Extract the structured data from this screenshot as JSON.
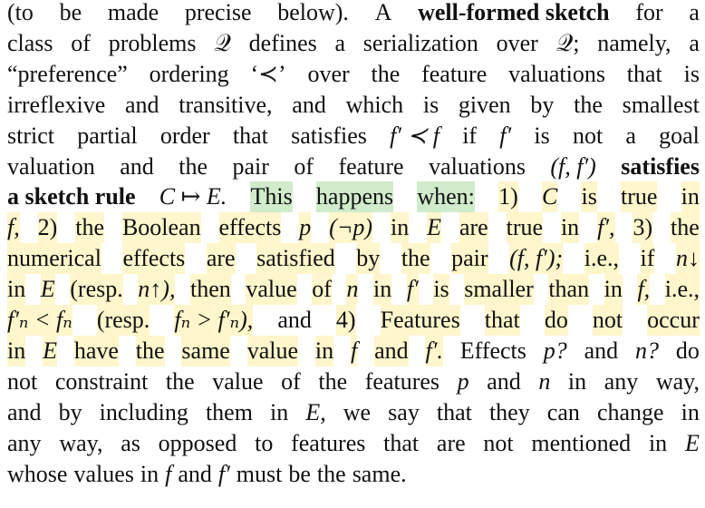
{
  "paragraph": {
    "lines": [
      [
        "(to",
        "be",
        "made",
        "precise",
        "below).",
        "A",
        "well-formed sketch",
        "for",
        "a"
      ],
      [
        "class",
        "of",
        "problems",
        "𝒬",
        "defines",
        "a",
        "serialization",
        "over",
        "𝒬;",
        "namely,",
        "a"
      ],
      [
        "“preference”",
        "ordering",
        "‘≺’",
        "over",
        "the",
        "feature",
        "valuations",
        "that",
        "is"
      ],
      [
        "irreflexive",
        "and",
        "transitive,",
        "and",
        "which",
        "is",
        "given",
        "by",
        "the",
        "smallest"
      ],
      [
        "strict",
        "partial",
        "order",
        "that",
        "satisfies",
        "f′ ≺ f",
        "if",
        "f′",
        "is",
        "not",
        "a",
        "goal"
      ],
      [
        "valuation",
        "and",
        "the",
        "pair",
        "of",
        "feature",
        "valuations",
        "(f, f′)",
        "satisfies"
      ],
      [
        "a sketch rule",
        "C ↦ E.",
        "This",
        "happens",
        "when:",
        "1)",
        "C",
        "is",
        "true",
        "in"
      ],
      [
        "f,",
        "2)",
        "the",
        "Boolean",
        "effects",
        "p",
        "(¬p)",
        "in",
        "E",
        "are",
        "true",
        "in",
        "f′,",
        "3)",
        "the"
      ],
      [
        "numerical",
        "effects",
        "are",
        "satisfied",
        "by",
        "the",
        "pair",
        "(f, f′);",
        "i.e.,",
        "if",
        "n↓"
      ],
      [
        "in",
        "E",
        "(resp.",
        "n↑),",
        "then",
        "value",
        "of",
        "n",
        "in",
        "f′",
        "is",
        "smaller",
        "than",
        "in",
        "f,",
        "i.e.,"
      ],
      [
        "f′ₙ < fₙ",
        "(resp.",
        "fₙ > f′ₙ),",
        "and",
        "4)",
        "Features",
        "that",
        "do",
        "not",
        "occur"
      ],
      [
        "in",
        "E",
        "have",
        "the",
        "same",
        "value",
        "in",
        "f",
        "and",
        "f′.",
        "Effects",
        "p?",
        "and",
        "n?",
        "do"
      ],
      [
        "not",
        "constraint",
        "the",
        "value",
        "of",
        "the",
        "features",
        "p",
        "and",
        "n",
        "in",
        "any",
        "way,"
      ],
      [
        "and",
        "by",
        "including",
        "them",
        "in",
        "E,",
        "we",
        "say",
        "that",
        "they",
        "can",
        "change",
        "in"
      ],
      [
        "any",
        "way,",
        "as",
        "opposed",
        "to",
        "features",
        "that",
        "are",
        "not",
        "mentioned",
        "in",
        "E"
      ],
      [
        "whose",
        "values",
        "in",
        "f",
        "and",
        "f′",
        "must",
        "be",
        "the",
        "same."
      ]
    ]
  },
  "colors": {
    "highlight_yellow": "#ffec8c",
    "highlight_green": "#aadca0",
    "text": "#111111"
  }
}
